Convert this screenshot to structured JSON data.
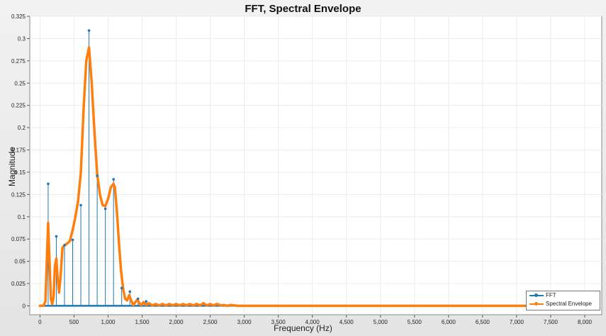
{
  "chart_data": {
    "type": "line",
    "title": "FFT, Spectral Envelope",
    "xlabel": "Frequency (Hz)",
    "ylabel": "Magnitude",
    "xlim": [
      -150,
      8250
    ],
    "ylim": [
      -0.01,
      0.325
    ],
    "x_ticks": [
      0,
      500,
      1000,
      1500,
      2000,
      2500,
      3000,
      3500,
      4000,
      4500,
      5000,
      5500,
      6000,
      6500,
      7000,
      7500,
      8000
    ],
    "x_tick_labels": [
      "0",
      "500",
      "1,000",
      "1,500",
      "2,000",
      "2,500",
      "3,000",
      "3,500",
      "4,000",
      "4,500",
      "5,000",
      "5,500",
      "6,000",
      "6,500",
      "7,000",
      "7,500",
      "8,000"
    ],
    "y_ticks": [
      0,
      0.025,
      0.05,
      0.075,
      0.1,
      0.125,
      0.15,
      0.175,
      0.2,
      0.225,
      0.25,
      0.275,
      0.3,
      0.325
    ],
    "y_tick_labels": [
      "0",
      "0.025",
      "0.05",
      "0.075",
      "0.1",
      "0.125",
      "0.15",
      "0.175",
      "0.2",
      "0.225",
      "0.25",
      "0.275",
      "0.3",
      "0.325"
    ],
    "grid": true,
    "legend_position": "bottom-right",
    "series": [
      {
        "name": "FFT",
        "color": "#1f77b4",
        "style": "stem",
        "x": [
          120,
          240,
          360,
          480,
          600,
          720,
          840,
          960,
          1080,
          1200,
          1320,
          1440,
          1560
        ],
        "y": [
          0.137,
          0.078,
          0.068,
          0.074,
          0.113,
          0.309,
          0.146,
          0.109,
          0.142,
          0.02,
          0.016,
          0.008,
          0.005
        ]
      },
      {
        "name": "Spectral Envelope",
        "color": "#ff7f0e",
        "style": "line",
        "x": [
          0,
          50,
          80,
          100,
          120,
          140,
          160,
          180,
          200,
          220,
          240,
          260,
          280,
          300,
          330,
          360,
          400,
          440,
          480,
          520,
          560,
          600,
          640,
          680,
          720,
          760,
          800,
          840,
          880,
          920,
          960,
          1000,
          1040,
          1080,
          1100,
          1130,
          1160,
          1190,
          1220,
          1250,
          1280,
          1310,
          1340,
          1370,
          1400,
          1430,
          1460,
          1490,
          1520,
          1560,
          1600,
          1650,
          1700,
          1750,
          1800,
          1850,
          1900,
          1950,
          2000,
          2050,
          2100,
          2150,
          2200,
          2250,
          2300,
          2350,
          2400,
          2450,
          2500,
          2550,
          2600,
          2650,
          2700,
          2750,
          2800,
          2900,
          3000,
          4000,
          5000,
          6000,
          7000,
          8000
        ],
        "y": [
          0,
          0.0,
          0.005,
          0.05,
          0.093,
          0.05,
          0.008,
          0.002,
          0.01,
          0.045,
          0.053,
          0.03,
          0.015,
          0.03,
          0.065,
          0.068,
          0.07,
          0.073,
          0.085,
          0.1,
          0.118,
          0.15,
          0.22,
          0.275,
          0.29,
          0.25,
          0.195,
          0.148,
          0.125,
          0.113,
          0.112,
          0.12,
          0.133,
          0.137,
          0.133,
          0.105,
          0.07,
          0.04,
          0.02,
          0.008,
          0.006,
          0.012,
          0.006,
          0.001,
          0.004,
          0.007,
          0.003,
          0.001,
          0.004,
          0.001,
          0.003,
          0.0005,
          0.002,
          0.0005,
          0.002,
          0.0005,
          0.002,
          0.0005,
          0.002,
          0.0005,
          0.002,
          0.0005,
          0.002,
          0.0005,
          0.002,
          0.0005,
          0.003,
          0.0005,
          0.002,
          0.0005,
          0.002,
          0.0005,
          0.001,
          0.0,
          0.001,
          0.0,
          0.0,
          0.0,
          0.0,
          0.0,
          0.0,
          0.0
        ]
      }
    ]
  }
}
